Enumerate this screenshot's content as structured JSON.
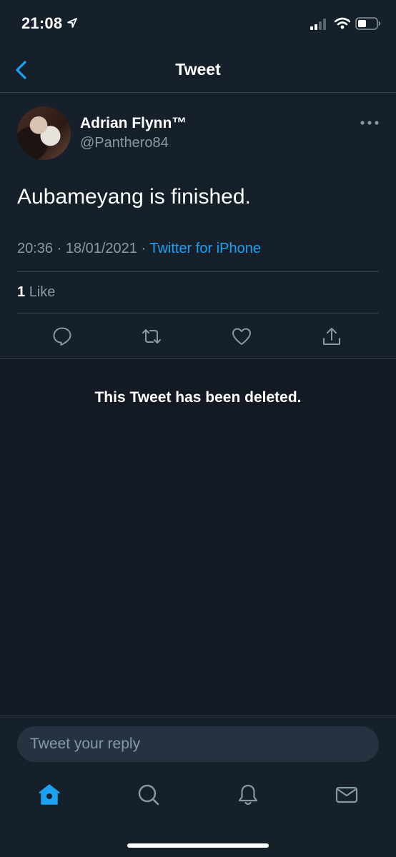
{
  "status_bar": {
    "time": "21:08",
    "location_icon": "location-arrow-icon",
    "signal_icon": "cellular-signal-icon",
    "wifi_icon": "wifi-icon",
    "battery_icon": "battery-icon"
  },
  "nav": {
    "title": "Tweet",
    "back_icon": "chevron-left-icon"
  },
  "tweet": {
    "author_name": "Adrian Flynn™",
    "author_handle": "@Panthero84",
    "text": "Aubameyang is finished.",
    "timestamp": "20:36 · 18/01/2021 · ",
    "source": "Twitter for iPhone",
    "like_count": "1",
    "like_label": "Like",
    "actions": [
      "reply-icon",
      "retweet-icon",
      "heart-icon",
      "share-icon"
    ]
  },
  "deleted_notice": "This Tweet has been deleted.",
  "reply": {
    "placeholder": "Tweet your reply"
  },
  "tab_bar": {
    "items": [
      "home-icon",
      "search-icon",
      "notifications-bell-icon",
      "messages-mail-icon"
    ],
    "active": "home-icon"
  },
  "colors": {
    "background": "#15202b",
    "accent": "#1da1f2",
    "secondary_text": "#8899a6",
    "border": "#38444d"
  }
}
